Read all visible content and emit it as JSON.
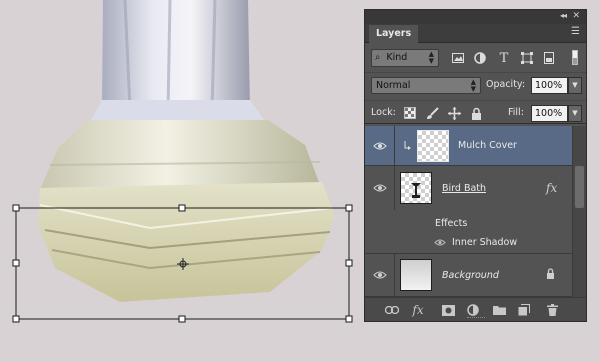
{
  "panel": {
    "collapse_glyph": "◂◂",
    "close_glyph": "✕",
    "tab_label": "Layers",
    "menu_glyph": "☰"
  },
  "filter": {
    "search_glyph": "⌕",
    "kind_label": "Kind",
    "icons": [
      "pixel-filter-icon",
      "adjustment-filter-icon",
      "type-filter-icon",
      "shape-filter-icon",
      "smart-object-filter-icon"
    ],
    "type_glyph": "T"
  },
  "blend": {
    "mode": "Normal",
    "opacity_label": "Opacity:",
    "opacity_value": "100%",
    "lock_label": "Lock:",
    "fill_label": "Fill:",
    "fill_value": "100%"
  },
  "layers": [
    {
      "name": "Mulch Cover",
      "selected": true,
      "clipped": true
    },
    {
      "name": "Bird Bath",
      "fx": "fx",
      "effects_label": "Effects",
      "effect_name": "Inner Shadow"
    },
    {
      "name": "Background",
      "locked": true
    }
  ],
  "bottom_icons": [
    "link-layers-icon",
    "add-style-icon",
    "add-mask-icon",
    "adjustment-layer-icon",
    "new-group-icon",
    "new-layer-icon",
    "delete-layer-icon"
  ],
  "bottom_fx": "fx",
  "colors": {
    "canvas_bg": "#d8d2d4",
    "panel_bg": "#535353",
    "selected_row": "#586a85"
  }
}
